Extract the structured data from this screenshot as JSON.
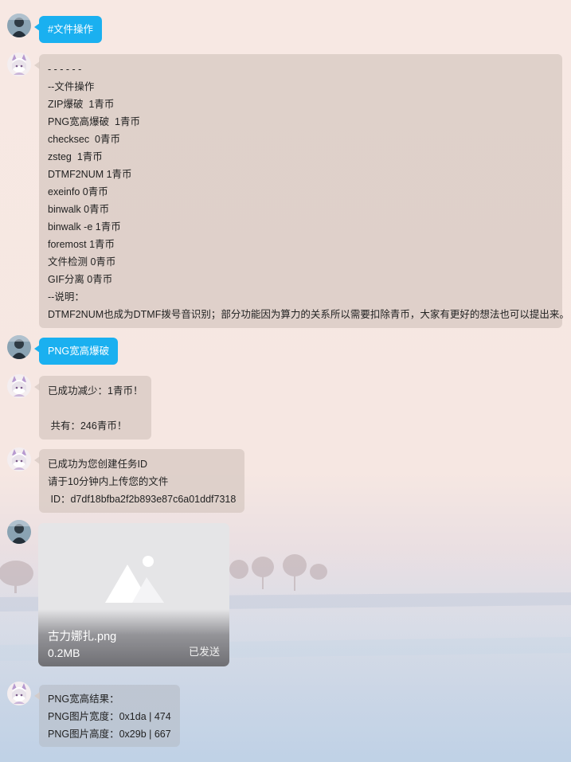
{
  "messages": {
    "m1": {
      "text": "#文件操作"
    },
    "m2": {
      "lines": [
        "- - - - - -",
        "--文件操作",
        "ZIP爆破  1青币",
        "PNG宽高爆破  1青币",
        "checksec  0青币",
        "zsteg  1青币",
        "DTMF2NUM 1青币",
        "exeinfo 0青币",
        "binwalk 0青币",
        "binwalk -e 1青币",
        "foremost 1青币",
        "文件检测 0青币",
        "GIF分离 0青币",
        "--说明：",
        "DTMF2NUM也成为DTMF拨号音识别；部分功能因为算力的关系所以需要扣除青币，大家有更好的想法也可以提出来。"
      ]
    },
    "m3": {
      "text": "PNG宽高爆破"
    },
    "m4": {
      "line1": "已成功减少：1青币！",
      "line2": " 共有：246青币！"
    },
    "m5": {
      "lines": [
        "已成功为您创建任务ID",
        "请于10分钟内上传您的文件",
        " ID：d7df18bfba2f2b893e87c6a01ddf7318"
      ]
    },
    "m6": {
      "file_name": "古力娜扎.png",
      "file_size": "0.2MB",
      "status": "已发送",
      "icon": "image-placeholder-icon"
    },
    "m7": {
      "lines": [
        "PNG宽高结果：",
        "PNG图片宽度：0x1da | 474",
        "PNG图片高度：0x29b | 667"
      ]
    }
  },
  "colors": {
    "user_bubble": "#1ab0f0",
    "bot_bubble": "#d6c8c0",
    "background_top": "#f7e8e3",
    "background_bottom": "#bcd0e6"
  }
}
